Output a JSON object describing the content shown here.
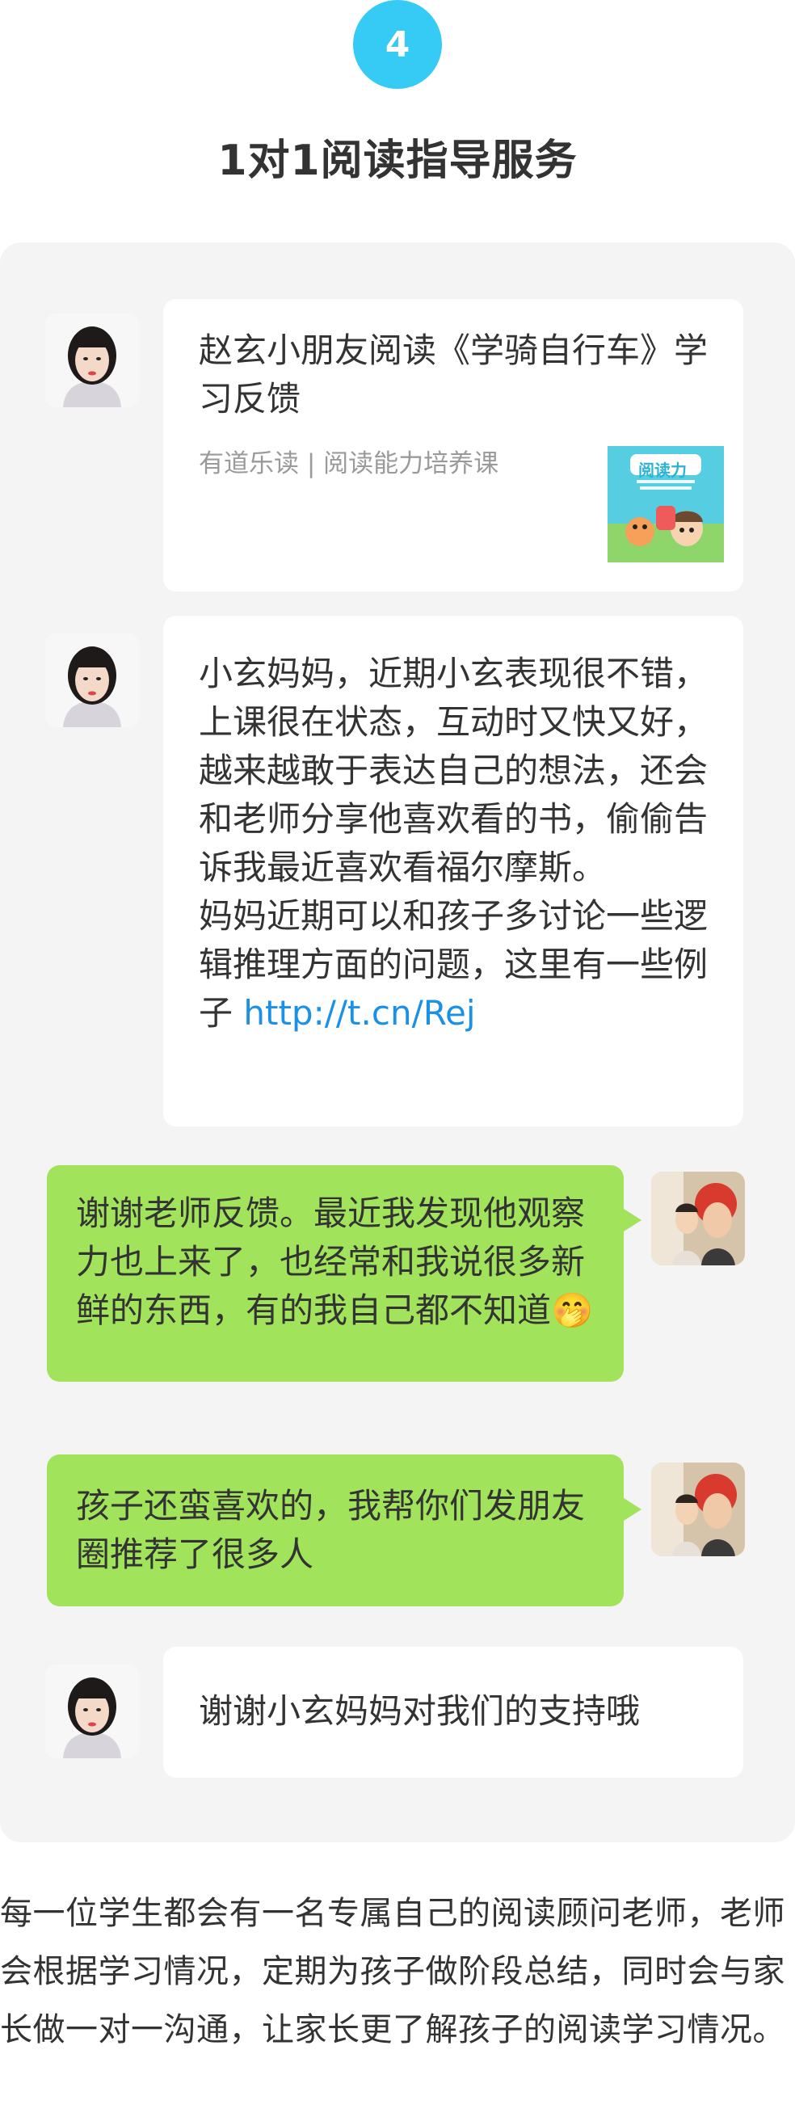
{
  "step": {
    "number": "4",
    "title": "1对1阅读指导服务"
  },
  "chat": {
    "card": {
      "title": "赵玄小朋友阅读《学骑自行车》学习反馈",
      "source": "有道乐读 | 阅读能力培养课",
      "thumb_text": "阅读力"
    },
    "teacher_message": {
      "text": "小玄妈妈，近期小玄表现很不错，上课很在状态，互动时又快又好，越来越敢于表达自己的想法，还会和老师分享他喜欢看的书，偷偷告诉我最近喜欢看福尔摩斯。\n妈妈近期可以和孩子多讨论一些逻辑推理方面的问题，这里有一些例子",
      "link": "http://t.cn/Rej"
    },
    "parent_message_1": {
      "text": "谢谢老师反馈。最近我发现他观察力也上来了，也经常和我说很多新鲜的东西，有的我自己都不知道",
      "emoji": "🤭"
    },
    "parent_message_2": {
      "text": "孩子还蛮喜欢的，我帮你们发朋友圈推荐了很多人"
    },
    "teacher_reply": {
      "text": "谢谢小玄妈妈对我们的支持哦"
    }
  },
  "footer": {
    "text": "每一位学生都会有一名专属自己的阅读顾问老师，老师会根据学习情况，定期为孩子做阶段总结，同时会与家长做一对一沟通，让家长更了解孩子的阅读学习情况。"
  },
  "colors": {
    "accent": "#36cbf5",
    "green_bubble": "#a2e35c",
    "panel": "#f4f4f4",
    "link": "#1a91e6"
  }
}
